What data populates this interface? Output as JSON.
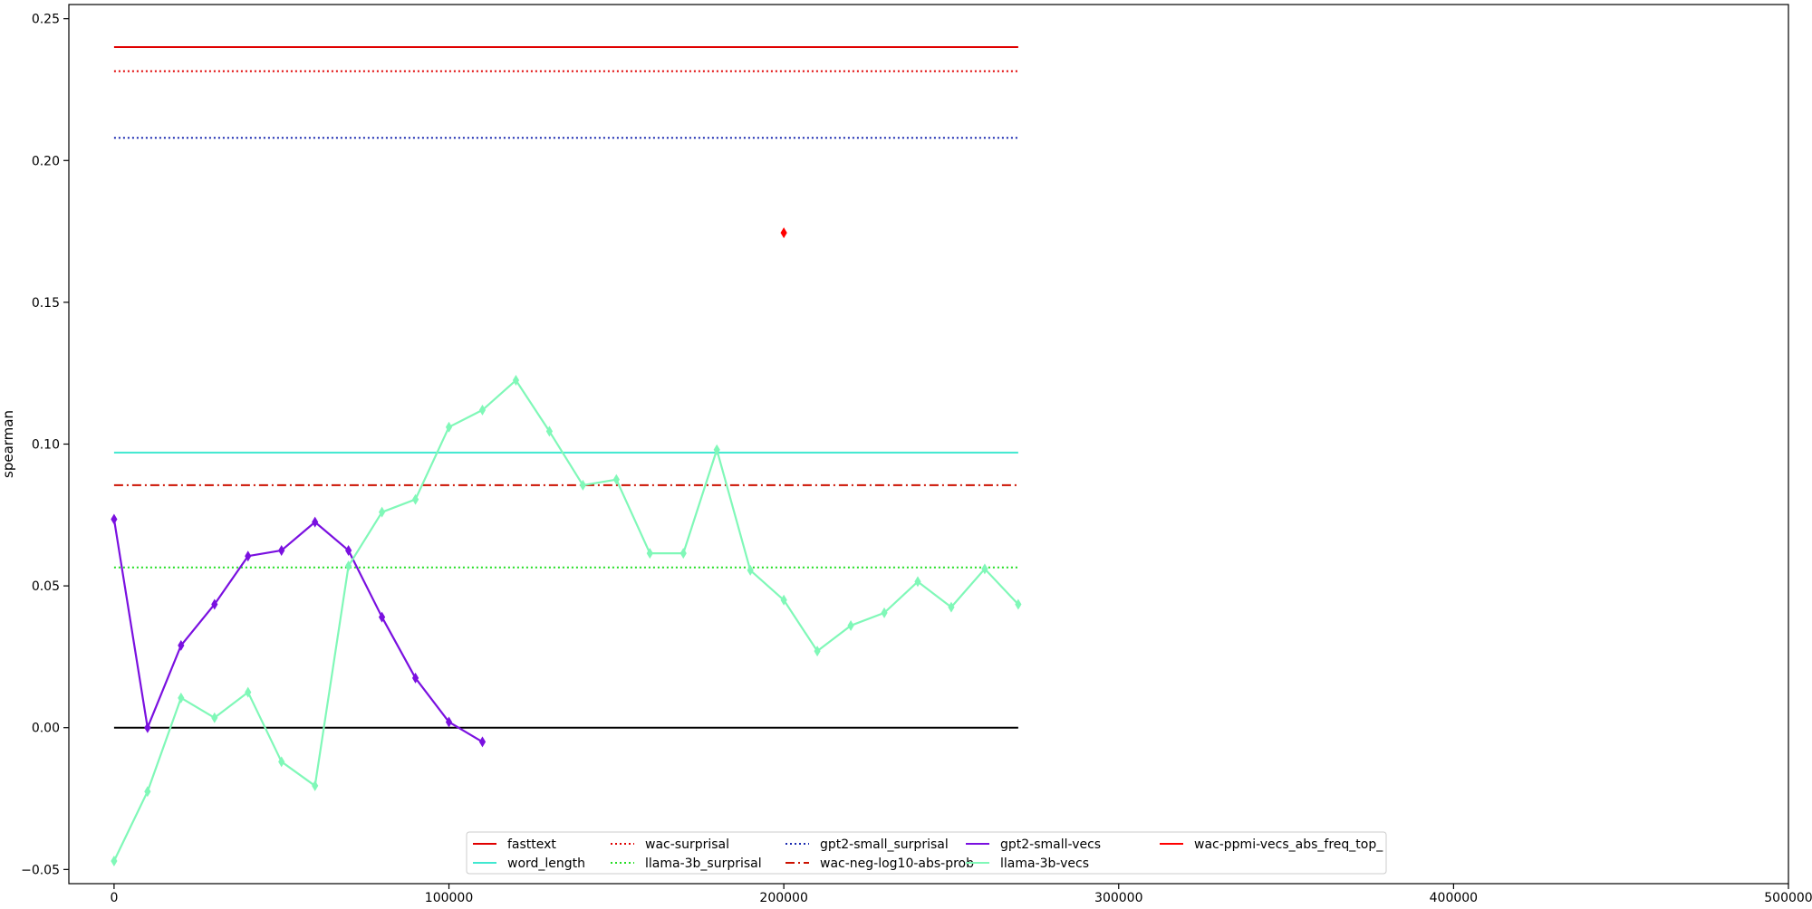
{
  "chart_data": {
    "type": "line",
    "title": "",
    "xlabel": "",
    "ylabel": "spearman",
    "xlim": [
      -13500,
      500000
    ],
    "ylim": [
      -0.055,
      0.255
    ],
    "xticks": [
      {
        "value": 0,
        "label": "0"
      },
      {
        "value": 100000,
        "label": "100000"
      },
      {
        "value": 200000,
        "label": "200000"
      },
      {
        "value": 300000,
        "label": "300000"
      },
      {
        "value": 400000,
        "label": "400000"
      },
      {
        "value": 500000,
        "label": "500000"
      }
    ],
    "yticks": [
      {
        "value": -0.05,
        "label": "−0.05"
      },
      {
        "value": 0.0,
        "label": "0.00"
      },
      {
        "value": 0.05,
        "label": "0.05"
      },
      {
        "value": 0.1,
        "label": "0.10"
      },
      {
        "value": 0.15,
        "label": "0.15"
      },
      {
        "value": 0.2,
        "label": "0.20"
      },
      {
        "value": 0.25,
        "label": "0.25"
      }
    ],
    "grid": false,
    "legend_position": "bottom-center",
    "baseline": {
      "y": 0.0,
      "x_range": [
        0,
        270000
      ],
      "color": "#000000"
    },
    "series": [
      {
        "name": "fasttext",
        "kind": "hline",
        "y": 0.24,
        "x_range": [
          0,
          270000
        ],
        "color": "#e00000",
        "dash": "solid"
      },
      {
        "name": "word_length",
        "kind": "hline",
        "y": 0.097,
        "x_range": [
          0,
          270000
        ],
        "color": "#40e8d0",
        "dash": "solid"
      },
      {
        "name": "wac-surprisal",
        "kind": "hline",
        "y": 0.2315,
        "x_range": [
          0,
          270000
        ],
        "color": "#e00000",
        "dash": "dotted"
      },
      {
        "name": "llama-3b_surprisal",
        "kind": "hline",
        "y": 0.0565,
        "x_range": [
          0,
          270000
        ],
        "color": "#22dd22",
        "dash": "dotted"
      },
      {
        "name": "gpt2-small_surprisal",
        "kind": "hline",
        "y": 0.208,
        "x_range": [
          0,
          270000
        ],
        "color": "#1a2ab0",
        "dash": "dotted"
      },
      {
        "name": "wac-neg-log10-abs-prob",
        "kind": "hline",
        "y": 0.0855,
        "x_range": [
          0,
          270000
        ],
        "color": "#cc1100",
        "dash": "dashdot"
      },
      {
        "name": "gpt2-small-vecs",
        "kind": "line",
        "color": "#7a10e0",
        "marker": "diamond",
        "x": [
          0,
          10000,
          20000,
          30000,
          40000,
          50000,
          60000,
          70000,
          80000,
          90000,
          100000,
          110000
        ],
        "y": [
          0.0735,
          0.0,
          0.029,
          0.0435,
          0.0605,
          0.0625,
          0.0725,
          0.0625,
          0.039,
          0.0175,
          0.002,
          -0.005
        ]
      },
      {
        "name": "llama-3b-vecs",
        "kind": "line",
        "color": "#80f8b8",
        "marker": "diamond",
        "x": [
          0,
          10000,
          20000,
          30000,
          40000,
          50000,
          60000,
          70000,
          80000,
          90000,
          100000,
          110000,
          120000,
          130000,
          140000,
          150000,
          160000,
          170000,
          180000,
          190000,
          200000,
          210000,
          220000,
          230000,
          240000,
          250000,
          260000,
          270000
        ],
        "y": [
          -0.047,
          -0.0225,
          0.0105,
          0.0035,
          0.0125,
          -0.012,
          -0.0205,
          0.057,
          0.076,
          0.0805,
          0.106,
          0.112,
          0.1225,
          0.1045,
          0.0855,
          0.0875,
          0.0615,
          0.0615,
          0.098,
          0.0555,
          0.045,
          0.027,
          0.036,
          0.0405,
          0.0515,
          0.0425,
          0.056,
          0.0435
        ]
      },
      {
        "name": "wac-ppmi-vecs_abs_freq_top_",
        "kind": "points",
        "color": "#ff0000",
        "marker": "diamond",
        "x": [
          200000
        ],
        "y": [
          0.1745
        ]
      }
    ],
    "legend_layout": [
      [
        "fasttext",
        "word_length"
      ],
      [
        "wac-surprisal",
        "llama-3b_surprisal"
      ],
      [
        "gpt2-small_surprisal",
        "wac-neg-log10-abs-prob"
      ],
      [
        "gpt2-small-vecs",
        "llama-3b-vecs"
      ],
      [
        "wac-ppmi-vecs_abs_freq_top_"
      ]
    ]
  }
}
